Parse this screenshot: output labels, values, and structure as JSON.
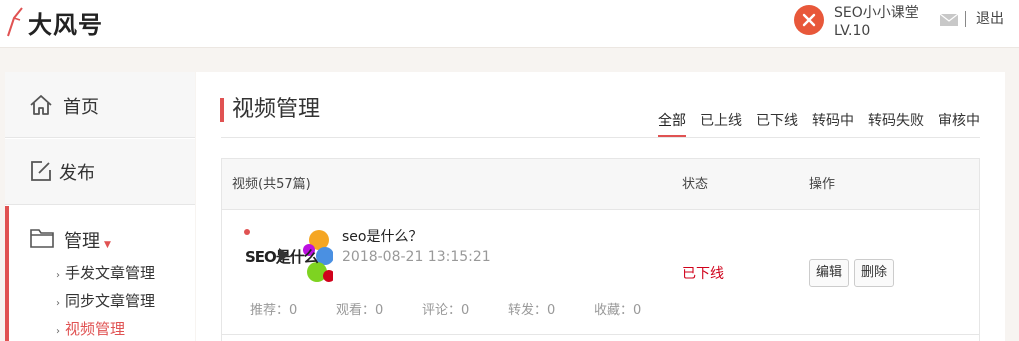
{
  "header": {
    "logo_text": "大风号",
    "user_name": "SEO小小课堂",
    "user_level": "LV.10",
    "logout_label": "退出"
  },
  "sidebar": {
    "home_label": "首页",
    "publish_label": "发布",
    "manage_label": "管理",
    "sub_items": [
      {
        "label": "手发文章管理"
      },
      {
        "label": "同步文章管理"
      },
      {
        "label": "视频管理"
      }
    ]
  },
  "main": {
    "title": "视频管理",
    "tabs": [
      {
        "label": "全部"
      },
      {
        "label": "已上线"
      },
      {
        "label": "已下线"
      },
      {
        "label": "转码中"
      },
      {
        "label": "转码失败"
      },
      {
        "label": "审核中"
      }
    ],
    "table": {
      "col_video": "视频(共57篇)",
      "col_status": "状态",
      "col_action": "操作",
      "rows": [
        {
          "thumb_text": "SEO是什么",
          "title": "seo是什么？",
          "date": "2018-08-21 13:15:21",
          "status": "已下线",
          "edit_label": "编辑",
          "delete_label": "删除",
          "stats": [
            {
              "label": "推荐：0"
            },
            {
              "label": "观看：0"
            },
            {
              "label": "评论：0"
            },
            {
              "label": "转发：0"
            },
            {
              "label": "收藏：0"
            }
          ]
        }
      ]
    }
  },
  "colors": {
    "accent": "#e05252",
    "status_offline": "#d0021b",
    "avatar": "#e8583a"
  }
}
